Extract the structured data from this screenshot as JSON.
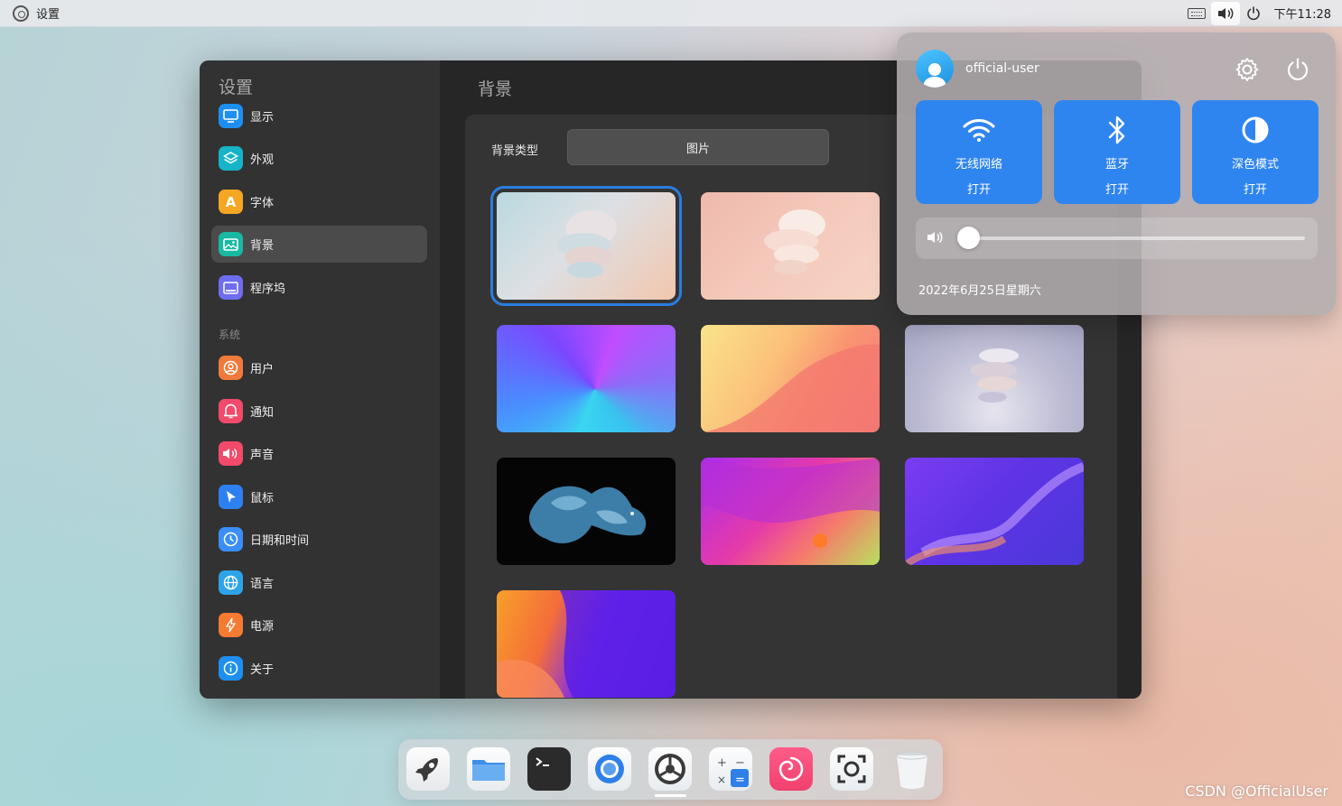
{
  "topbar": {
    "app_name": "设置",
    "time": "下午11:28",
    "icons": [
      "keyboard-icon",
      "volume-icon",
      "power-icon"
    ]
  },
  "window": {
    "sidebar": {
      "title": "设置",
      "items": [
        {
          "label": "显示",
          "icon": "display-icon",
          "color": "#1e8ff0"
        },
        {
          "label": "外观",
          "icon": "appearance-icon",
          "color": "#16b4c8"
        },
        {
          "label": "字体",
          "icon": "font-icon",
          "color": "#f5a623"
        },
        {
          "label": "背景",
          "icon": "background-icon",
          "color": "#19b8a3",
          "selected": true
        },
        {
          "label": "程序坞",
          "icon": "dock-icon",
          "color": "#6f6cf0"
        }
      ],
      "section_label": "系统",
      "system_items": [
        {
          "label": "用户",
          "icon": "user-icon",
          "color": "#f07a3b"
        },
        {
          "label": "通知",
          "icon": "notification-icon",
          "color": "#f24a6a"
        },
        {
          "label": "声音",
          "icon": "sound-icon",
          "color": "#f24a6a"
        },
        {
          "label": "鼠标",
          "icon": "mouse-icon",
          "color": "#2e80f0"
        },
        {
          "label": "日期和时间",
          "icon": "clock-icon",
          "color": "#3a8ef5"
        },
        {
          "label": "语言",
          "icon": "globe-icon",
          "color": "#2ea3e8"
        },
        {
          "label": "电源",
          "icon": "power-icon",
          "color": "#f57a32"
        },
        {
          "label": "关于",
          "icon": "info-icon",
          "color": "#1e8ff0"
        }
      ]
    },
    "main": {
      "title": "背景",
      "background_type_label": "背景类型",
      "background_type_value": "图片",
      "wallpapers": [
        {
          "name": "wallpaper-1",
          "selected": true
        },
        {
          "name": "wallpaper-2"
        },
        {
          "name": "wallpaper-3"
        },
        {
          "name": "wallpaper-4"
        },
        {
          "name": "wallpaper-5"
        },
        {
          "name": "wallpaper-6"
        },
        {
          "name": "wallpaper-7"
        },
        {
          "name": "wallpaper-8"
        },
        {
          "name": "wallpaper-9"
        }
      ]
    }
  },
  "control_center": {
    "username": "official-user",
    "tiles": [
      {
        "label": "无线网络",
        "state": "打开",
        "icon": "wifi-icon"
      },
      {
        "label": "蓝牙",
        "state": "打开",
        "icon": "bluetooth-icon"
      },
      {
        "label": "深色模式",
        "state": "打开",
        "icon": "dark-mode-icon"
      }
    ],
    "volume": 0.0,
    "date": "2022年6月25日星期六",
    "accent": "#2f85f0"
  },
  "dock": {
    "items": [
      "launcher-icon",
      "files-icon",
      "terminal-icon",
      "browser-icon",
      "settings-icon",
      "calculator-icon",
      "debian-icon",
      "screenshot-icon",
      "trash-icon"
    ],
    "active": "settings-icon"
  },
  "watermark": "CSDN @OfficialUser"
}
